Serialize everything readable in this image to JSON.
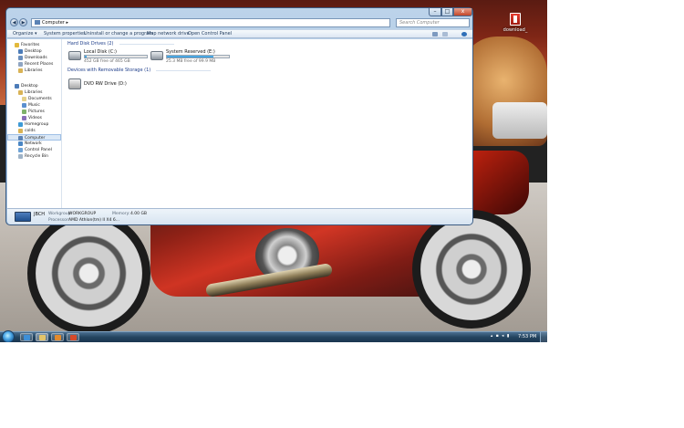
{
  "desktop": {
    "icon_label": "download_"
  },
  "window": {
    "buttons": {
      "minimize": "–",
      "maximize": "□",
      "close": "x"
    },
    "address": {
      "breadcrumb": "Computer",
      "separator": "▸"
    },
    "search": {
      "placeholder": "Search Computer"
    },
    "nav_buttons": {
      "back": "◀",
      "forward": "▶"
    }
  },
  "toolbar": {
    "organize": "Organize ▾",
    "system_properties": "System properties",
    "uninstall": "Uninstall or change a program",
    "map_drive": "Map network drive",
    "control_panel": "Open Control Panel"
  },
  "nav": {
    "favorites": "Favorites",
    "desktop_fav": "Desktop",
    "downloads": "Downloads",
    "recent_places": "Recent Places",
    "libraries_fav": "Libraries",
    "desktop": "Desktop",
    "libraries": "Libraries",
    "documents": "Documents",
    "music": "Music",
    "pictures": "Pictures",
    "videos": "Videos",
    "homegroup": "Homegroup",
    "user": "colds",
    "computer": "Computer",
    "network": "Network",
    "control_panel": "Control Panel",
    "recycle_bin": "Recycle Bin"
  },
  "main": {
    "hdd_header": "Hard Disk Drives (2)",
    "removable_header": "Devices with Removable Storage (1)",
    "drives": [
      {
        "name": "Local Disk (C:)",
        "free": "452 GB free of 465 GB",
        "used_fraction": 0.03
      },
      {
        "name": "System Reserved (E:)",
        "free": "25.3 MB free of 99.9 MB",
        "used_fraction": 0.75
      }
    ],
    "dvd": {
      "name": "DVD RW Drive (D:)"
    }
  },
  "details": {
    "pc_name": "JBCH",
    "workgroup_label": "Workgroup:",
    "workgroup_value": "WORKGROUP",
    "memory_label": "Memory:",
    "memory_value": "4.00 GB",
    "processor_label": "Processor:",
    "processor_value": "AMD Athlon(tm) II X4 6..."
  },
  "taskbar": {
    "tray": "▴ ▪ ◂ ▮",
    "clock": "7:53 PM"
  }
}
